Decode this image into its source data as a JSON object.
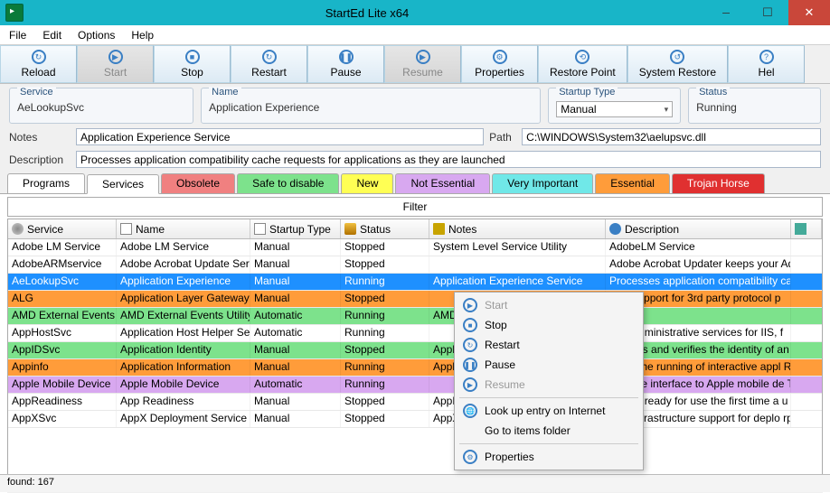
{
  "title": "StartEd Lite x64",
  "menu": [
    "File",
    "Edit",
    "Options",
    "Help"
  ],
  "toolbar": [
    {
      "label": "Reload",
      "icon": "↻"
    },
    {
      "label": "Start",
      "icon": "▶",
      "pressed": true,
      "disabled": true
    },
    {
      "label": "Stop",
      "icon": "■"
    },
    {
      "label": "Restart",
      "icon": "↻"
    },
    {
      "label": "Pause",
      "icon": "❚❚"
    },
    {
      "label": "Resume",
      "icon": "▶",
      "pressed": true,
      "disabled": true
    },
    {
      "label": "Properties",
      "icon": "⚙"
    },
    {
      "label": "Restore Point",
      "icon": "⟲"
    },
    {
      "label": "System Restore",
      "icon": "↺"
    },
    {
      "label": "Hel",
      "icon": "?"
    }
  ],
  "info": {
    "service": {
      "legend": "Service",
      "value": "AeLookupSvc"
    },
    "name": {
      "legend": "Name",
      "value": "Application Experience"
    },
    "startup": {
      "legend": "Startup Type",
      "value": "Manual"
    },
    "status": {
      "legend": "Status",
      "value": "Running"
    }
  },
  "notes": {
    "label": "Notes",
    "value": "Application Experience Service"
  },
  "path": {
    "label": "Path",
    "value": "C:\\WINDOWS\\System32\\aelupsvc.dll"
  },
  "description": {
    "label": "Description",
    "value": "Processes application compatibility cache requests for applications as they are launched"
  },
  "tabs": [
    "Programs",
    "Services",
    "Obsolete",
    "Safe to disable",
    "New",
    "Not Essential",
    "Very Important",
    "Essential",
    "Trojan Horse"
  ],
  "filter": "Filter",
  "headers": [
    "Service",
    "Name",
    "Startup Type",
    "Status",
    "Notes",
    "Description"
  ],
  "rows": [
    {
      "cls": "",
      "c": [
        "Adobe LM Service",
        "Adobe LM Service",
        "Manual",
        "Stopped",
        "System Level Service Utility",
        "AdobeLM Service"
      ]
    },
    {
      "cls": "",
      "c": [
        "AdobeARMservice",
        "Adobe Acrobat Update Servi",
        "Manual",
        "Stopped",
        "",
        "Adobe Acrobat Updater keeps your Adob"
      ]
    },
    {
      "cls": "sel",
      "c": [
        "AeLookupSvc",
        "Application Experience",
        "Manual",
        "Running",
        "Application Experience Service",
        "Processes application compatibility cache"
      ]
    },
    {
      "cls": "hl-orange",
      "c": [
        "ALG",
        "Application Layer Gateway S",
        "Manual",
        "Stopped",
        "",
        "ides support for 3rd party protocol p"
      ]
    },
    {
      "cls": "hl-green",
      "c": [
        "AMD External Events Uti",
        "AMD External Events Utility",
        "Automatic",
        "Running",
        "AMD E",
        ""
      ]
    },
    {
      "cls": "",
      "c": [
        "AppHostSvc",
        "Application Host Helper Serv",
        "Automatic",
        "Running",
        "",
        "ides administrative services for IIS, f"
      ]
    },
    {
      "cls": "hl-green",
      "c": [
        "AppIDSvc",
        "Application Identity",
        "Manual",
        "Stopped",
        "Applic",
        "ermines and verifies the identity of an Rpc"
      ]
    },
    {
      "cls": "hl-orange",
      "c": [
        "Appinfo",
        "Application Information",
        "Manual",
        "Running",
        "Applic",
        "itates the running of interactive appl Rpc"
      ]
    },
    {
      "cls": "hl-purple",
      "c": [
        "Apple Mobile Device",
        "Apple Mobile Device",
        "Automatic",
        "Running",
        "",
        "ides the interface to Apple mobile de Tcp"
      ]
    },
    {
      "cls": "",
      "c": [
        "AppReadiness",
        "App Readiness",
        "Manual",
        "Stopped",
        "AppRe",
        "s apps ready for use the first time a u"
      ]
    },
    {
      "cls": "",
      "c": [
        "AppXSvc",
        "AppX Deployment Service (A",
        "Manual",
        "Stopped",
        "AppX",
        "ides infrastructure support for deplo rpc"
      ]
    }
  ],
  "context": [
    {
      "label": "Start",
      "icon": "▶",
      "disabled": true
    },
    {
      "label": "Stop",
      "icon": "■"
    },
    {
      "label": "Restart",
      "icon": "↻"
    },
    {
      "label": "Pause",
      "icon": "❚❚"
    },
    {
      "label": "Resume",
      "icon": "▶",
      "disabled": true
    },
    {
      "sep": true
    },
    {
      "label": "Look up entry on Internet",
      "icon": "🌐"
    },
    {
      "label": "Go to items folder",
      "icon": ""
    },
    {
      "sep": true
    },
    {
      "label": "Properties",
      "icon": "⚙"
    }
  ],
  "statusbar": "found: 167"
}
